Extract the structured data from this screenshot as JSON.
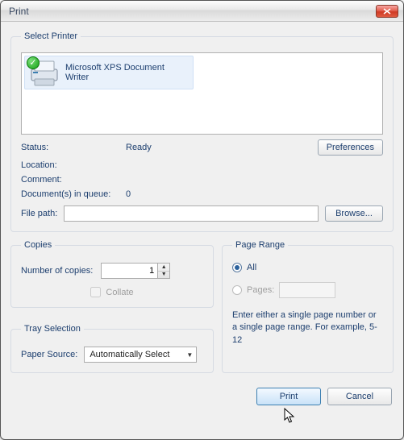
{
  "window": {
    "title": "Print"
  },
  "select_printer": {
    "legend": "Select Printer",
    "selected_name": "Microsoft XPS Document Writer"
  },
  "status": {
    "status_label": "Status:",
    "status_value": "Ready",
    "location_label": "Location:",
    "location_value": "",
    "comment_label": "Comment:",
    "comment_value": "",
    "queue_label": "Document(s) in queue:",
    "queue_value": "0",
    "preferences_btn": "Preferences"
  },
  "filepath": {
    "label": "File path:",
    "value": "",
    "browse_btn": "Browse..."
  },
  "copies": {
    "legend": "Copies",
    "label": "Number of copies:",
    "value": "1",
    "collate_label": "Collate"
  },
  "tray": {
    "legend": "Tray Selection",
    "label": "Paper Source:",
    "value": "Automatically Select"
  },
  "page_range": {
    "legend": "Page Range",
    "all_label": "All",
    "pages_label": "Pages:",
    "pages_value": "",
    "hint": "Enter either a single page number or a single page range. For example, 5-12"
  },
  "buttons": {
    "print": "Print",
    "cancel": "Cancel"
  }
}
